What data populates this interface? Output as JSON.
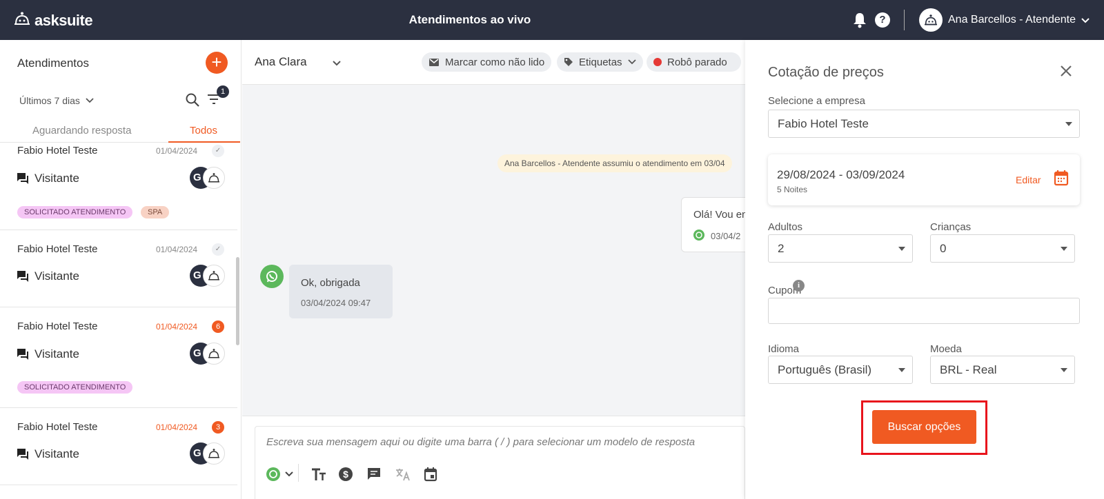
{
  "header": {
    "logo_text": "asksuite",
    "title": "Atendimentos ao vivo",
    "user_name": "Ana Barcellos - Atendente",
    "help_label": "?"
  },
  "sidebar": {
    "title": "Atendimentos",
    "add_label": "+",
    "period": "Últimos 7 dias",
    "filter_count": "1",
    "tabs": [
      {
        "label": "Aguardando resposta",
        "active": false
      },
      {
        "label": "Todos",
        "active": true
      }
    ],
    "conversations": [
      {
        "hotel": "Fabio Hotel Teste",
        "date": "01/04/2024",
        "status": "read",
        "visitor": "Visitante",
        "avatar_initial": "G",
        "tags": [
          "SOLICITADO ATENDIMENTO",
          "SPA"
        ]
      },
      {
        "hotel": "Fabio Hotel Teste",
        "date": "01/04/2024",
        "status": "read",
        "visitor": "Visitante",
        "avatar_initial": "G",
        "tags": []
      },
      {
        "hotel": "Fabio Hotel Teste",
        "date": "01/04/2024",
        "status": "unread",
        "unread_count": "6",
        "visitor": "Visitante",
        "avatar_initial": "G",
        "tags": [
          "SOLICITADO ATENDIMENTO"
        ]
      },
      {
        "hotel": "Fabio Hotel Teste",
        "date": "01/04/2024",
        "status": "unread",
        "unread_count": "3",
        "visitor": "Visitante",
        "avatar_initial": "G",
        "tags": []
      }
    ]
  },
  "chat": {
    "contact_name": "Ana Clara",
    "actions": {
      "mark_unread": "Marcar como não lido",
      "tags": "Etiquetas",
      "robot_status": "Robô parado"
    },
    "system_message": "Ana Barcellos - Atendente assumiu o atendimento em 03/04",
    "outgoing": {
      "text": "Olá! Vou en",
      "time": "03/04/2"
    },
    "incoming": {
      "text": "Ok, obrigada",
      "time": "03/04/2024 09:47"
    },
    "composer_placeholder": "Escreva sua mensagem aqui ou digite uma barra ( / ) para selecionar um modelo de resposta"
  },
  "quote_panel": {
    "title": "Cotação de preços",
    "company_label": "Selecione a empresa",
    "company_value": "Fabio Hotel Teste",
    "date_range": "29/08/2024 - 03/09/2024",
    "nights": "5 Noites",
    "edit_label": "Editar",
    "adults_label": "Adultos",
    "adults_value": "2",
    "children_label": "Crianças",
    "children_value": "0",
    "coupon_label": "Cupom",
    "coupon_value": "",
    "language_label": "Idioma",
    "language_value": "Português (Brasil)",
    "currency_label": "Moeda",
    "currency_value": "BRL - Real",
    "search_button": "Buscar opções"
  },
  "colors": {
    "accent": "#f05a22",
    "topbar": "#2b3040",
    "highlight": "#e8141c",
    "whatsapp": "#5cb85c"
  }
}
